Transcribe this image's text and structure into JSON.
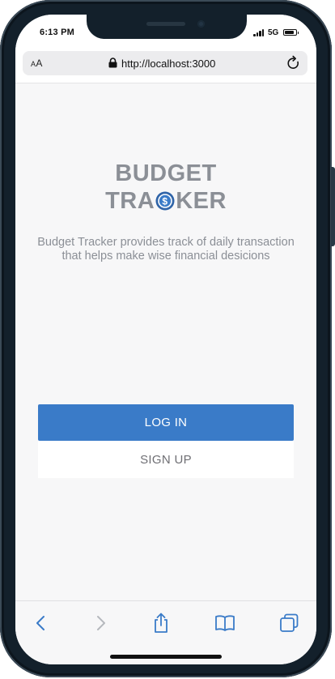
{
  "status_bar": {
    "time": "6:13 PM",
    "network": "5G",
    "battery_level": 0.85
  },
  "browser": {
    "aa_small": "A",
    "aa_large": "A",
    "url": "http://localhost:3000",
    "lock_icon": "lock-icon",
    "reload_icon": "reload-icon"
  },
  "app": {
    "logo_line1": "BUDGET",
    "logo_line2_start": "TRA",
    "logo_line2_end": "KER",
    "logo_coin_icon": "dollar-coin-icon",
    "tagline": "Budget Tracker provides track of daily transaction that helps make wise financial desicions",
    "login_label": "LOG IN",
    "signup_label": "SIGN UP",
    "primary_color": "#3a7bc8",
    "text_gray": "#8b8f96"
  },
  "toolbar": {
    "icons": [
      "back-icon",
      "forward-icon",
      "share-icon",
      "bookmarks-icon",
      "tabs-icon"
    ],
    "accent": "#3a7bc8",
    "disabled": "#b5b8bd"
  }
}
